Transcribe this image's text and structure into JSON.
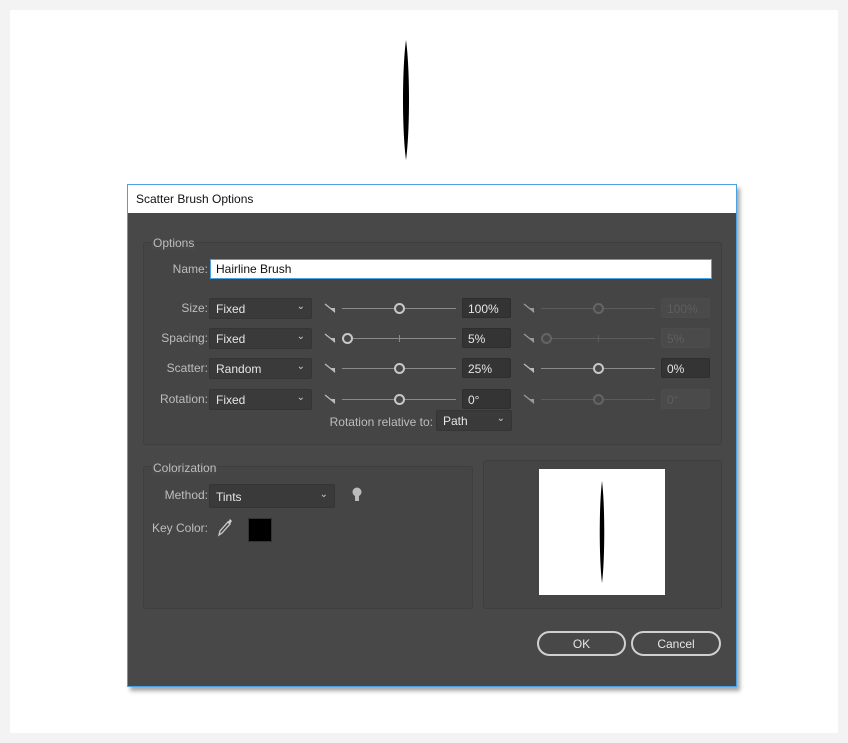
{
  "dialog": {
    "title": "Scatter Brush Options"
  },
  "options": {
    "group_label": "Options",
    "name_label": "Name:",
    "name_value": "Hairline Brush",
    "rows": [
      {
        "label": "Size:",
        "method": "Fixed",
        "slider1": 0.5,
        "value1": "100%",
        "slider2": 0.5,
        "value2": "100%",
        "second_enabled": false,
        "ticked": false
      },
      {
        "label": "Spacing:",
        "method": "Fixed",
        "slider1": 0.04,
        "value1": "5%",
        "slider2": 0.04,
        "value2": "5%",
        "second_enabled": false,
        "ticked": true
      },
      {
        "label": "Scatter:",
        "method": "Random",
        "slider1": 0.5,
        "value1": "25%",
        "slider2": 0.5,
        "value2": "0%",
        "second_enabled": true,
        "ticked": false
      },
      {
        "label": "Rotation:",
        "method": "Fixed",
        "slider1": 0.5,
        "value1": "0°",
        "slider2": 0.5,
        "value2": "0°",
        "second_enabled": false,
        "ticked": false
      }
    ],
    "rotation_relative_label": "Rotation relative to:",
    "rotation_relative_value": "Path"
  },
  "colorization": {
    "group_label": "Colorization",
    "method_label": "Method:",
    "method_value": "Tints",
    "tips_icon": "lightbulb-icon",
    "key_color_label": "Key Color:",
    "eyedropper_icon": "eyedropper-icon",
    "key_color": "#000000"
  },
  "buttons": {
    "ok": "OK",
    "cancel": "Cancel"
  },
  "colors": {
    "accent": "#4aa3df",
    "dialog_bg": "#484848"
  }
}
